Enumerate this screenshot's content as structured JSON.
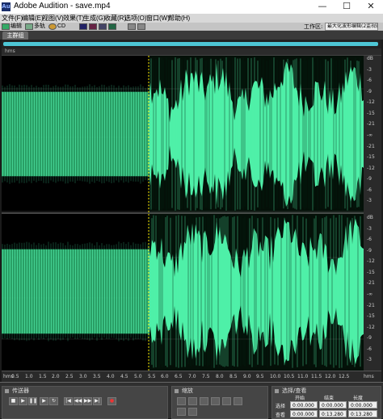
{
  "window": {
    "app_icon": "Au",
    "title": "Adobe Audition - save.mp4",
    "controls": [
      "—",
      "☐",
      "✕"
    ]
  },
  "menu": [
    "文件(F)",
    "编辑(E)",
    "视图(V)",
    "效果(T)",
    "生成(G)",
    "收藏(R)",
    "选项(O)",
    "窗口(W)",
    "帮助(H)"
  ],
  "toolbar": {
    "mode_edit": "编辑",
    "mode_multitrack": "多轨",
    "mode_cd": "CD",
    "workspace_label": "工作区:",
    "workspace_value": "最大化波形编辑(2监视器)"
  },
  "tab": {
    "label": "主群组"
  },
  "editor": {
    "ruler_unit": "hms",
    "wave_color": "#4ff0a8",
    "selection_end_sec": 5.5,
    "total_sec": 13.28
  },
  "db_scale": {
    "top_channel": [
      "dB",
      "-3",
      "-6",
      "-9",
      "-12",
      "-15",
      "-21",
      "-∞",
      "-21",
      "-15",
      "-12",
      "-9",
      "-6",
      "-3"
    ],
    "bottom_channel": [
      "dB",
      "-3",
      "-6",
      "-9",
      "-12",
      "-15",
      "-21",
      "-∞",
      "-21",
      "-15",
      "-12",
      "-9",
      "-6",
      "-3"
    ]
  },
  "time_ruler": {
    "unit": "hms",
    "ticks": [
      "0.5",
      "1.0",
      "1.5",
      "2.0",
      "2.5",
      "3.0",
      "3.5",
      "4.0",
      "4.5",
      "5.0",
      "5.5",
      "6.0",
      "6.5",
      "7.0",
      "7.5",
      "8.0",
      "8.5",
      "9.0",
      "9.5",
      "10.0",
      "10.5",
      "11.0",
      "11.5",
      "12.0",
      "12.5"
    ],
    "end_unit": "hms"
  },
  "transport": {
    "title": "传送器",
    "buttons_row1": [
      "■",
      "▶",
      "❚❚",
      "▶",
      "↻"
    ],
    "buttons_row2": [
      "|◀",
      "◀◀",
      "▶▶",
      "▶|",
      "●"
    ]
  },
  "zoom": {
    "title": "缩放"
  },
  "selection": {
    "title": "选择/查看",
    "col_start": "开始",
    "col_end": "结束",
    "col_length": "长度",
    "row_select": "选择",
    "row_view": "查看",
    "sel_start": "0:00.000",
    "sel_end": "0:00.000",
    "sel_length": "0:00.000",
    "view_start": "0:00.000",
    "view_end": "0:13.280",
    "view_length": "0:13.280"
  }
}
